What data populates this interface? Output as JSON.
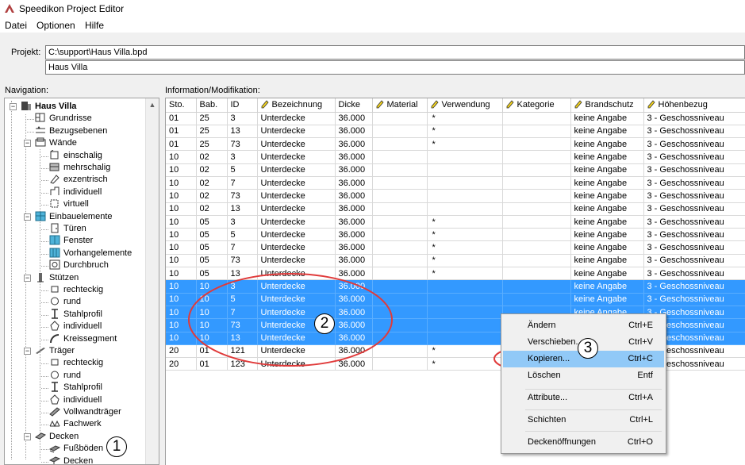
{
  "window": {
    "title": "Speedikon Project Editor"
  },
  "menubar": {
    "items": [
      "Datei",
      "Optionen",
      "Hilfe"
    ]
  },
  "project": {
    "label": "Projekt:",
    "path": "C:\\support\\Haus Villa.bpd",
    "name": "Haus Villa"
  },
  "navigation": {
    "label": "Navigation:",
    "tree": [
      {
        "label": "Haus Villa",
        "icon": "building-icon",
        "level": 0,
        "expander": "−",
        "bold": true
      },
      {
        "label": "Grundrisse",
        "icon": "floorplan-icon",
        "level": 1
      },
      {
        "label": "Bezugsebenen",
        "icon": "reference-levels-icon",
        "level": 1
      },
      {
        "label": "Wände",
        "icon": "wall-icon",
        "level": 1,
        "expander": "−"
      },
      {
        "label": "einschalig",
        "icon": "wall-single-icon",
        "level": 2
      },
      {
        "label": "mehrschalig",
        "icon": "wall-multi-icon",
        "level": 2
      },
      {
        "label": "exzentrisch",
        "icon": "wall-eccentric-icon",
        "level": 2
      },
      {
        "label": "individuell",
        "icon": "wall-individual-icon",
        "level": 2
      },
      {
        "label": "virtuell",
        "icon": "wall-virtual-icon",
        "level": 2
      },
      {
        "label": "Einbauelemente",
        "icon": "fixtures-icon",
        "level": 1,
        "expander": "−"
      },
      {
        "label": "Türen",
        "icon": "door-icon",
        "level": 2
      },
      {
        "label": "Fenster",
        "icon": "window-icon",
        "level": 2
      },
      {
        "label": "Vorhangelemente",
        "icon": "curtain-wall-icon",
        "level": 2
      },
      {
        "label": "Durchbruch",
        "icon": "opening-icon",
        "level": 2
      },
      {
        "label": "Stützen",
        "icon": "column-icon",
        "level": 1,
        "expander": "−"
      },
      {
        "label": "rechteckig",
        "icon": "rectangle-icon",
        "level": 2
      },
      {
        "label": "rund",
        "icon": "circle-icon",
        "level": 2
      },
      {
        "label": "Stahlprofil",
        "icon": "steel-profile-icon",
        "level": 2
      },
      {
        "label": "individuell",
        "icon": "custom-shape-icon",
        "level": 2
      },
      {
        "label": "Kreissegment",
        "icon": "circle-segment-icon",
        "level": 2
      },
      {
        "label": "Träger",
        "icon": "beam-icon",
        "level": 1,
        "expander": "−"
      },
      {
        "label": "rechteckig",
        "icon": "rectangle-icon",
        "level": 2
      },
      {
        "label": "rund",
        "icon": "circle-icon",
        "level": 2
      },
      {
        "label": "Stahlprofil",
        "icon": "steel-profile-icon",
        "level": 2
      },
      {
        "label": "individuell",
        "icon": "custom-shape-icon",
        "level": 2
      },
      {
        "label": "Vollwandträger",
        "icon": "plate-girder-icon",
        "level": 2
      },
      {
        "label": "Fachwerk",
        "icon": "truss-icon",
        "level": 2
      },
      {
        "label": "Decken",
        "icon": "slab-icon",
        "level": 1,
        "expander": "−"
      },
      {
        "label": "Fußböden",
        "icon": "floor-covering-icon",
        "level": 2
      },
      {
        "label": "Decken",
        "icon": "ceiling-icon",
        "level": 2
      }
    ]
  },
  "info": {
    "label": "Information/Modifikation:",
    "columns": [
      {
        "label": "Sto.",
        "editable": false
      },
      {
        "label": "Bab.",
        "editable": false
      },
      {
        "label": "ID",
        "editable": false
      },
      {
        "label": "Bezeichnung",
        "editable": true
      },
      {
        "label": "Dicke",
        "editable": false
      },
      {
        "label": "Material",
        "editable": true
      },
      {
        "label": "Verwendung",
        "editable": true
      },
      {
        "label": "Kategorie",
        "editable": true
      },
      {
        "label": "Brandschutz",
        "editable": true
      },
      {
        "label": "Höhenbezug",
        "editable": true
      }
    ],
    "rows": [
      {
        "cells": [
          "01",
          "25",
          "3",
          "Unterdecke",
          "36.000",
          "",
          "*",
          "",
          "keine Angabe",
          "3 - Geschossniveau"
        ],
        "selected": false
      },
      {
        "cells": [
          "01",
          "25",
          "13",
          "Unterdecke",
          "36.000",
          "",
          "*",
          "",
          "keine Angabe",
          "3 - Geschossniveau"
        ],
        "selected": false
      },
      {
        "cells": [
          "01",
          "25",
          "73",
          "Unterdecke",
          "36.000",
          "",
          "*",
          "",
          "keine Angabe",
          "3 - Geschossniveau"
        ],
        "selected": false
      },
      {
        "cells": [
          "10",
          "02",
          "3",
          "Unterdecke",
          "36.000",
          "",
          "",
          "",
          "keine Angabe",
          "3 - Geschossniveau"
        ],
        "selected": false
      },
      {
        "cells": [
          "10",
          "02",
          "5",
          "Unterdecke",
          "36.000",
          "",
          "",
          "",
          "keine Angabe",
          "3 - Geschossniveau"
        ],
        "selected": false
      },
      {
        "cells": [
          "10",
          "02",
          "7",
          "Unterdecke",
          "36.000",
          "",
          "",
          "",
          "keine Angabe",
          "3 - Geschossniveau"
        ],
        "selected": false
      },
      {
        "cells": [
          "10",
          "02",
          "73",
          "Unterdecke",
          "36.000",
          "",
          "",
          "",
          "keine Angabe",
          "3 - Geschossniveau"
        ],
        "selected": false
      },
      {
        "cells": [
          "10",
          "02",
          "13",
          "Unterdecke",
          "36.000",
          "",
          "",
          "",
          "keine Angabe",
          "3 - Geschossniveau"
        ],
        "selected": false
      },
      {
        "cells": [
          "10",
          "05",
          "3",
          "Unterdecke",
          "36.000",
          "",
          "*",
          "",
          "keine Angabe",
          "3 - Geschossniveau"
        ],
        "selected": false
      },
      {
        "cells": [
          "10",
          "05",
          "5",
          "Unterdecke",
          "36.000",
          "",
          "*",
          "",
          "keine Angabe",
          "3 - Geschossniveau"
        ],
        "selected": false
      },
      {
        "cells": [
          "10",
          "05",
          "7",
          "Unterdecke",
          "36.000",
          "",
          "*",
          "",
          "keine Angabe",
          "3 - Geschossniveau"
        ],
        "selected": false
      },
      {
        "cells": [
          "10",
          "05",
          "73",
          "Unterdecke",
          "36.000",
          "",
          "*",
          "",
          "keine Angabe",
          "3 - Geschossniveau"
        ],
        "selected": false
      },
      {
        "cells": [
          "10",
          "05",
          "13",
          "Unterdecke",
          "36.000",
          "",
          "*",
          "",
          "keine Angabe",
          "3 - Geschossniveau"
        ],
        "selected": false
      },
      {
        "cells": [
          "10",
          "10",
          "3",
          "Unterdecke",
          "36.000",
          "",
          "",
          "",
          "keine Angabe",
          "3 - Geschossniveau"
        ],
        "selected": true
      },
      {
        "cells": [
          "10",
          "10",
          "5",
          "Unterdecke",
          "36.000",
          "",
          "",
          "",
          "keine Angabe",
          "3 - Geschossniveau"
        ],
        "selected": true
      },
      {
        "cells": [
          "10",
          "10",
          "7",
          "Unterdecke",
          "36.000",
          "",
          "",
          "",
          "keine Angabe",
          "3 - Geschossniveau"
        ],
        "selected": true
      },
      {
        "cells": [
          "10",
          "10",
          "73",
          "Unterdecke",
          "36.000",
          "",
          "",
          "",
          "keine Angabe",
          "3 - Geschossniveau"
        ],
        "selected": true
      },
      {
        "cells": [
          "10",
          "10",
          "13",
          "Unterdecke",
          "36.000",
          "",
          "",
          "",
          "keine Angabe",
          "3 - Geschossniveau"
        ],
        "selected": true
      },
      {
        "cells": [
          "20",
          "01",
          "121",
          "Unterdecke",
          "36.000",
          "",
          "*",
          "",
          "keine Angabe",
          "3 - Geschossniveau"
        ],
        "selected": false
      },
      {
        "cells": [
          "20",
          "01",
          "123",
          "Unterdecke",
          "36.000",
          "",
          "*",
          "",
          "keine Angabe",
          "3 - Geschossniveau"
        ],
        "selected": false
      }
    ]
  },
  "context_menu": {
    "items": [
      {
        "label": "Ändern",
        "shortcut": "Ctrl+E"
      },
      {
        "label": "Verschieben...",
        "shortcut": "Ctrl+V"
      },
      {
        "label": "Kopieren...",
        "shortcut": "Ctrl+C",
        "highlighted": true
      },
      {
        "label": "Löschen",
        "shortcut": "Entf"
      },
      {
        "label": "Attribute...",
        "shortcut": "Ctrl+A"
      },
      {
        "label": "Schichten",
        "shortcut": "Ctrl+L"
      },
      {
        "label": "Deckenöffnungen",
        "shortcut": "Ctrl+O"
      }
    ]
  },
  "annotations": {
    "callouts": [
      "1",
      "2",
      "3"
    ],
    "color": "#e03a3a"
  },
  "colors": {
    "selection": "#3399ff",
    "menu_highlight": "#91c9f7",
    "pencil": "#f2d21b"
  }
}
